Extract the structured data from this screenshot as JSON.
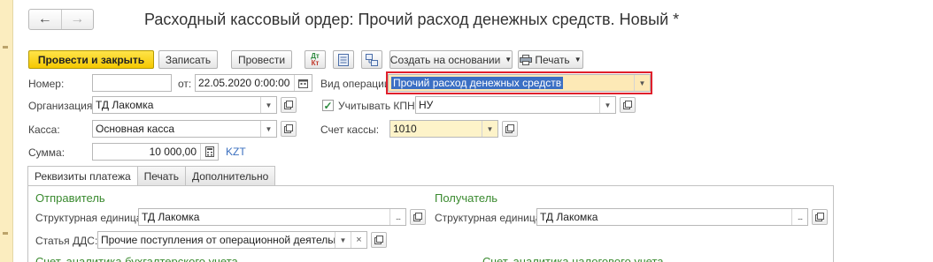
{
  "window": {
    "title": "Расходный кассовый ордер: Прочий расход денежных средств. Новый *",
    "nav_back": "←",
    "nav_forward": "→"
  },
  "toolbar": {
    "post_close": "Провести и закрыть",
    "save": "Записать",
    "post": "Провести",
    "dtkt_icon_text_top": "Дт",
    "dtkt_icon_text_bottom": "Кт",
    "create_based_on": "Создать на основании",
    "print": "Печать"
  },
  "form": {
    "number_label": "Номер:",
    "number_value": "",
    "date_label": "от:",
    "date_value": "22.05.2020  0:00:00",
    "operation_label": "Вид операции:",
    "operation_value": "Прочий расход денежных средств",
    "org_label": "Организация:",
    "org_value": "ТД Лакомка",
    "kpn_label": "Учитывать КПН",
    "kpn_checked": true,
    "kpn_value": "НУ",
    "cash_label": "Касса:",
    "cash_value": "Основная касса",
    "cash_account_label": "Счет кассы:",
    "cash_account_value": "1010",
    "sum_label": "Сумма:",
    "sum_value": "10 000,00",
    "currency": "KZT"
  },
  "tabs": [
    {
      "label": "Реквизиты платежа",
      "active": true
    },
    {
      "label": "Печать",
      "active": false
    },
    {
      "label": "Дополнительно",
      "active": false
    }
  ],
  "payment": {
    "sender_heading": "Отправитель",
    "receiver_heading": "Получатель",
    "sender_unit_label": "Структурная единица:",
    "sender_unit_value": "ТД Лакомка",
    "receiver_unit_label": "Структурная единица:",
    "receiver_unit_value": "ТД Лакомка",
    "dds_label": "Статья ДДС:",
    "dds_value": "Прочие поступления от операционной деятельност",
    "accounting_heading": "Счет, аналитика бухгалтерского учета",
    "tax_heading": "Счет, аналитика налогового учета"
  },
  "colors": {
    "primary_button": "#f5c800",
    "highlight_border": "#e0202b",
    "section_heading": "#3a8a2f",
    "selection": "#3b6fc4"
  }
}
